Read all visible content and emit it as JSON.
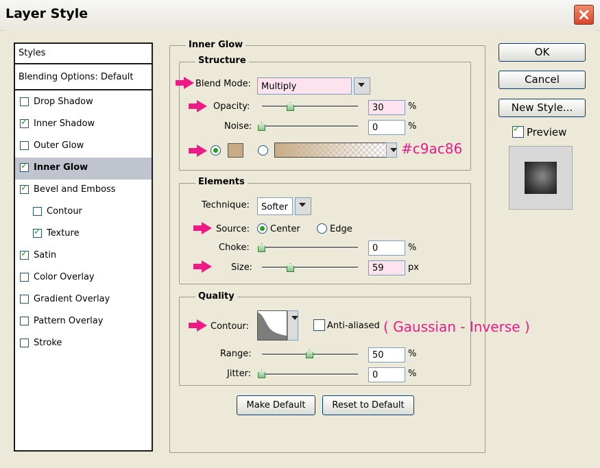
{
  "window": {
    "title": "Layer Style"
  },
  "styles_panel": {
    "header": "Styles",
    "blending": "Blending Options: Default",
    "items": [
      {
        "label": "Drop Shadow",
        "checked": false
      },
      {
        "label": "Inner Shadow",
        "checked": true
      },
      {
        "label": "Outer Glow",
        "checked": false
      },
      {
        "label": "Inner Glow",
        "checked": true,
        "selected": true
      },
      {
        "label": "Bevel and Emboss",
        "checked": true
      },
      {
        "label": "Contour",
        "checked": false,
        "indent": true
      },
      {
        "label": "Texture",
        "checked": true,
        "indent": true
      },
      {
        "label": "Satin",
        "checked": true
      },
      {
        "label": "Color Overlay",
        "checked": false
      },
      {
        "label": "Gradient Overlay",
        "checked": false
      },
      {
        "label": "Pattern Overlay",
        "checked": false
      },
      {
        "label": "Stroke",
        "checked": false
      }
    ]
  },
  "inner_glow": {
    "title": "Inner Glow",
    "structure": {
      "title": "Structure",
      "blend_mode_label": "Blend Mode:",
      "blend_mode_value": "Multiply",
      "opacity_label": "Opacity:",
      "opacity_value": "30",
      "opacity_unit": "%",
      "opacity_fraction": 0.3,
      "noise_label": "Noise:",
      "noise_value": "0",
      "noise_unit": "%",
      "noise_fraction": 0.0,
      "color_annotation": "#c9ac86",
      "glow_color": "#c9ac86"
    },
    "elements": {
      "title": "Elements",
      "technique_label": "Technique:",
      "technique_value": "Softer",
      "source_label": "Source:",
      "source_center": "Center",
      "source_edge": "Edge",
      "choke_label": "Choke:",
      "choke_value": "0",
      "choke_unit": "%",
      "choke_fraction": 0.0,
      "size_label": "Size:",
      "size_value": "59",
      "size_unit": "px",
      "size_fraction": 0.3
    },
    "quality": {
      "title": "Quality",
      "contour_label": "Contour:",
      "anti_aliased_label": "Anti-aliased",
      "contour_annotation": "( Gaussian - Inverse )",
      "range_label": "Range:",
      "range_value": "50",
      "range_unit": "%",
      "range_fraction": 0.5,
      "jitter_label": "Jitter:",
      "jitter_value": "0",
      "jitter_unit": "%",
      "jitter_fraction": 0.0
    },
    "make_default": "Make Default",
    "reset_default": "Reset to Default"
  },
  "buttons": {
    "ok": "OK",
    "cancel": "Cancel",
    "new_style": "New Style...",
    "preview": "Preview"
  },
  "colors": {
    "accent_pink": "#ee1a86",
    "check_green": "#21a121"
  }
}
